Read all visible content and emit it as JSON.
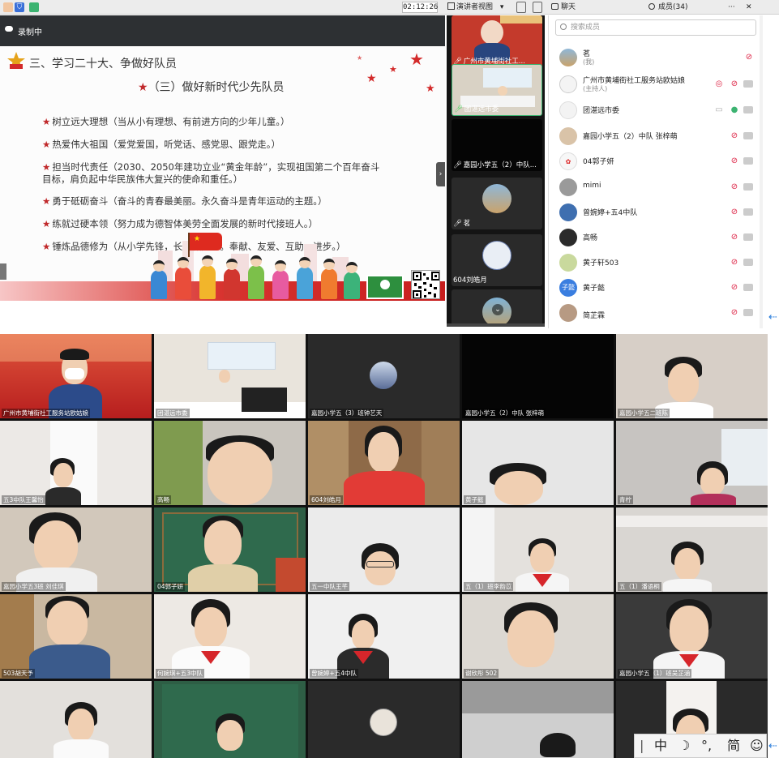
{
  "titlebar": {
    "timer": "02:12:26",
    "view_mode": "演讲者视图",
    "view_mode_caret": "▾",
    "chat_label": "聊天",
    "members_label": "成员(34)",
    "more": "···",
    "close": "✕"
  },
  "recording": {
    "label": "录制中"
  },
  "slide": {
    "title": "三、学习二十大、争做好队员",
    "subtitle": "（三）做好新时代少先队员",
    "bullets": [
      "树立远大理想（当从小有理想、有前进方向的少年儿童。）",
      "热爱伟大祖国（爱党爱国，听党话、感党恩、跟党走。）",
      "担当时代责任（2030、2050年建功立业“黄金年龄”，实现祖国第二个百年奋斗目标，肩负起中华民族伟大复兴的使命和重任。）",
      "勇于砥砺奋斗（奋斗的青春最美丽。永久奋斗是青年运动的主题。）",
      "练就过硬本领（努力成为德智体美劳全面发展的新时代接班人。）",
      "锤炼品德修为（从小学先锋，长大做先锋。奉献、友爱、互助、进步。）"
    ]
  },
  "thumbnails": [
    {
      "label": "广州市黄埔街社工..."
    },
    {
      "label": "团湛远市委"
    },
    {
      "label": "嘉园小学五（2）中队..."
    },
    {
      "label": "茗"
    },
    {
      "label": "604刘皓月"
    },
    {
      "label": ""
    }
  ],
  "members": {
    "search_placeholder": "搜索成员",
    "list": [
      {
        "name": "茗",
        "sub": "(我)"
      },
      {
        "name": "广州市黄埔街社工服务站欧姑娘",
        "sub": "(主持人)"
      },
      {
        "name": "团湛远市委",
        "sub": ""
      },
      {
        "name": "嘉园小学五（2）中队 张梓萌",
        "sub": ""
      },
      {
        "name": "04郭子妍",
        "sub": ""
      },
      {
        "name": "mimi",
        "sub": ""
      },
      {
        "name": "曾婉婷+五4中队",
        "sub": ""
      },
      {
        "name": "高畅",
        "sub": ""
      },
      {
        "name": "黄子轩503",
        "sub": ""
      },
      {
        "name": "黄子懿",
        "sub": "",
        "avatar_text": "子懿"
      },
      {
        "name": "简芷霖",
        "sub": ""
      }
    ]
  },
  "gallery": [
    {
      "label": "广州市黄埔街社工服务站欧姑娘"
    },
    {
      "label": "团湛远市委"
    },
    {
      "label": "嘉园小学五（3）班钟艺天"
    },
    {
      "label": "嘉园小学五（2）中队 张梓萌"
    },
    {
      "label": "嘉园小学五二班陈"
    },
    {
      "label": "五3中队王馨怡"
    },
    {
      "label": "高畅"
    },
    {
      "label": "604刘皓月"
    },
    {
      "label": "黄子懿"
    },
    {
      "label": "青柠"
    },
    {
      "label": "嘉园小学五3班 刘佳琪"
    },
    {
      "label": "04郭子妍"
    },
    {
      "label": "五一中队王芊"
    },
    {
      "label": "五（1）班李韵苡"
    },
    {
      "label": "五（1）潘语桐"
    },
    {
      "label": "503胡天予"
    },
    {
      "label": "何婉琪+五3中队"
    },
    {
      "label": "曾婉婷+五4中队"
    },
    {
      "label": "谢欣彤 502"
    },
    {
      "label": "嘉园小学五（1）班吴芷涵"
    },
    {
      "label": ""
    },
    {
      "label": ""
    },
    {
      "label": ""
    },
    {
      "label": ""
    },
    {
      "label": ""
    }
  ],
  "ime": {
    "bar": "|",
    "lang": "中",
    "moon": "☽",
    "punct": "°,",
    "simplified": "简",
    "emoji": "☺"
  },
  "colors": {
    "accent_red": "#c0292b",
    "toolbar_bg": "#ececec",
    "thumb_bg": "#141414",
    "link_blue": "#2d7fdc"
  }
}
